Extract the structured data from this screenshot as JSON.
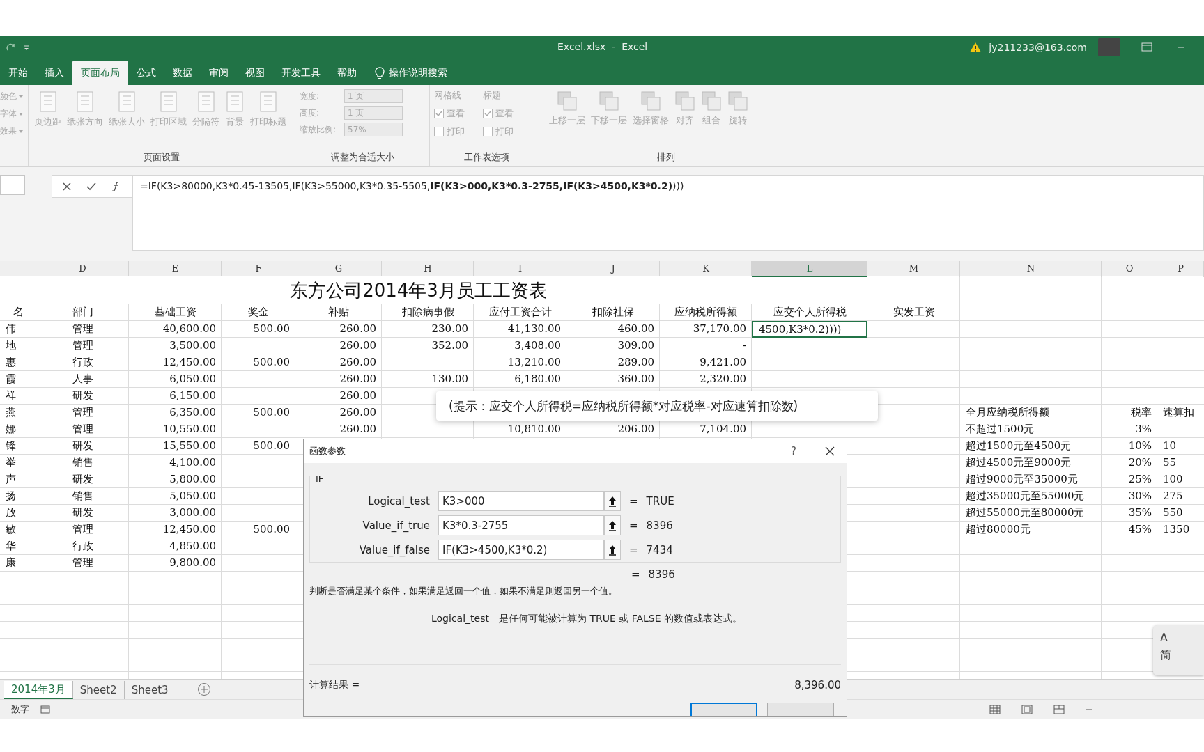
{
  "window": {
    "title": "Excel.xlsx  -  Excel",
    "account": "jy211233@163.com"
  },
  "ribbon_tabs": [
    {
      "label": "开始",
      "selected": false
    },
    {
      "label": "插入",
      "selected": false
    },
    {
      "label": "页面布局",
      "selected": true
    },
    {
      "label": "公式",
      "selected": false
    },
    {
      "label": "数据",
      "selected": false
    },
    {
      "label": "审阅",
      "selected": false
    },
    {
      "label": "视图",
      "selected": false
    },
    {
      "label": "开发工具",
      "selected": false
    },
    {
      "label": "帮助",
      "selected": false
    }
  ],
  "tell_me": "操作说明搜索",
  "ribbon": {
    "disabled": true,
    "theme_items": [
      "颜色",
      "字体",
      "效果"
    ],
    "page_setup": {
      "label": "页面设置",
      "buttons": [
        "页边距",
        "纸张方向",
        "纸张大小",
        "打印区域",
        "分隔符",
        "背景",
        "打印标题"
      ]
    },
    "scale_to_fit": {
      "label": "调整为合适大小",
      "fields": [
        {
          "label": "宽度:",
          "value": "1 页"
        },
        {
          "label": "高度:",
          "value": "1 页"
        },
        {
          "label": "缩放比例:",
          "value": "57%"
        }
      ]
    },
    "sheet_options": {
      "label": "工作表选项",
      "groups": [
        {
          "title": "网格线",
          "options": [
            {
              "label": "查看",
              "checked": true
            },
            {
              "label": "打印",
              "checked": false
            }
          ]
        },
        {
          "title": "标题",
          "options": [
            {
              "label": "查看",
              "checked": true
            },
            {
              "label": "打印",
              "checked": false
            }
          ]
        }
      ]
    },
    "arrange": {
      "label": "排列",
      "buttons": [
        "上移一层",
        "下移一层",
        "选择窗格",
        "对齐",
        "组合",
        "旋转"
      ]
    }
  },
  "formula_bar": {
    "formula": "=IF(K3>80000,K3*0.45-13505,IF(K3>55000,K3*0.35-5505,**IF(K3>000,K3*0.3-2755,IF(K3>4500,K3*0.2)**)))"
  },
  "sheet": {
    "columns": [
      {
        "label": "D",
        "selected": false
      },
      {
        "label": "E",
        "selected": false
      },
      {
        "label": "F",
        "selected": false
      },
      {
        "label": "G",
        "selected": false
      },
      {
        "label": "H",
        "selected": false
      },
      {
        "label": "I",
        "selected": false
      },
      {
        "label": "J",
        "selected": false
      },
      {
        "label": "K",
        "selected": false
      },
      {
        "label": "L",
        "selected": true
      },
      {
        "label": "M",
        "selected": false
      },
      {
        "label": "N",
        "selected": false
      },
      {
        "label": "O",
        "selected": false
      },
      {
        "label": "P",
        "selected": false
      }
    ],
    "title": "东方公司2014年3月员工工资表",
    "headers": {
      "C": "名",
      "D": "部门",
      "E": "基础工资",
      "F": "奖金",
      "G": "补贴",
      "H": "扣除病事假",
      "I": "应付工资合计",
      "J": "扣除社保",
      "K": "应纳税所得额",
      "L": "应交个人所得税",
      "M": "实发工资"
    },
    "rows": [
      {
        "cells": {
          "C": "伟",
          "D": "管理",
          "E": "40,600.00",
          "F": "500.00",
          "G": "260.00",
          "H": "230.00",
          "I": "41,130.00",
          "J": "460.00",
          "K": "37,170.00",
          "L": {
            "text": "4500,K3*0.2))))",
            "selected": true
          }
        }
      },
      {
        "cells": {
          "C": "地",
          "D": "管理",
          "E": "3,500.00",
          "G": "260.00",
          "H": "352.00",
          "I": "3,408.00",
          "J": "309.00",
          "K": "-"
        }
      },
      {
        "cells": {
          "C": "惠",
          "D": "行政",
          "E": "12,450.00",
          "F": "500.00",
          "G": "260.00",
          "I": "13,210.00",
          "J": "289.00",
          "K": "9,421.00"
        }
      },
      {
        "cells": {
          "C": "霞",
          "D": "人事",
          "E": "6,050.00",
          "G": "260.00",
          "H": "130.00",
          "I": "6,180.00",
          "J": "360.00",
          "K": "2,320.00"
        }
      },
      {
        "cells": {
          "C": "祥",
          "D": "研发",
          "E": "6,150.00",
          "G": "260.00"
        }
      },
      {
        "cells": {
          "C": "燕",
          "D": "管理",
          "E": "6,350.00",
          "F": "500.00",
          "G": "260.00",
          "N": "全月应纳税所得额",
          "O": "税率",
          "P": "速算扣"
        }
      },
      {
        "cells": {
          "C": "娜",
          "D": "管理",
          "E": "10,550.00",
          "G": "260.00",
          "I": "10,810.00",
          "J": "206.00",
          "K": "7,104.00",
          "N": "不超过1500元",
          "O": "3%"
        }
      },
      {
        "cells": {
          "C": "锋",
          "D": "研发",
          "E": "15,550.00",
          "F": "500.00",
          "N": "超过1500元至4500元",
          "O": "10%",
          "P": "10"
        }
      },
      {
        "cells": {
          "C": "举",
          "D": "销售",
          "E": "4,100.00",
          "N": "超过4500元至9000元",
          "O": "20%",
          "P": "55"
        }
      },
      {
        "cells": {
          "C": "声",
          "D": "研发",
          "E": "5,800.00",
          "N": "超过9000元至35000元",
          "O": "25%",
          "P": "100"
        }
      },
      {
        "cells": {
          "C": "扬",
          "D": "销售",
          "E": "5,050.00",
          "N": "超过35000元至55000元",
          "O": "30%",
          "P": "275"
        }
      },
      {
        "cells": {
          "C": "放",
          "D": "研发",
          "E": "3,000.00",
          "N": "超过55000元至80000元",
          "O": "35%",
          "P": "550"
        }
      },
      {
        "cells": {
          "C": "敏",
          "D": "管理",
          "E": "12,450.00",
          "F": "500.00",
          "N": "超过80000元",
          "O": "45%",
          "P": "1350"
        }
      },
      {
        "cells": {
          "C": "华",
          "D": "行政",
          "E": "4,850.00"
        }
      },
      {
        "cells": {
          "C": "康",
          "D": "管理",
          "E": "9,800.00"
        }
      }
    ]
  },
  "sheet_tabs": [
    {
      "label": "2014年3月",
      "selected": true
    },
    {
      "label": "Sheet2",
      "selected": false
    },
    {
      "label": "Sheet3",
      "selected": false
    }
  ],
  "status_bar": {
    "mode": "数字"
  },
  "tooltip": "(提示：应交个人所得税=应纳税所得额*对应税率-对应速算扣除数)",
  "dialog": {
    "title": "函数参数",
    "help": "?",
    "function": "IF",
    "args": [
      {
        "name": "Logical_test",
        "value": "K3>000",
        "equals": "=",
        "result": "TRUE"
      },
      {
        "name": "Value_if_true",
        "value": "K3*0.3-2755",
        "equals": "=",
        "result": "8396"
      },
      {
        "name": "Value_if_false",
        "value": "IF(K3>4500,K3*0.2)",
        "equals": "=",
        "result": "7434"
      }
    ],
    "formula_result": {
      "equals": "=",
      "value": "8396"
    },
    "description": "判断是否满足某个条件，如果满足返回一个值，如果不满足则返回另一个值。",
    "arg_name": "Logical_test",
    "arg_help": "是任何可能被计算为 TRUE 或 FALSE 的数值或表达式。",
    "result_label": "计算结果 =",
    "result_value": "8,396.00"
  },
  "ime": {
    "lang": "A",
    "mode": "简"
  }
}
